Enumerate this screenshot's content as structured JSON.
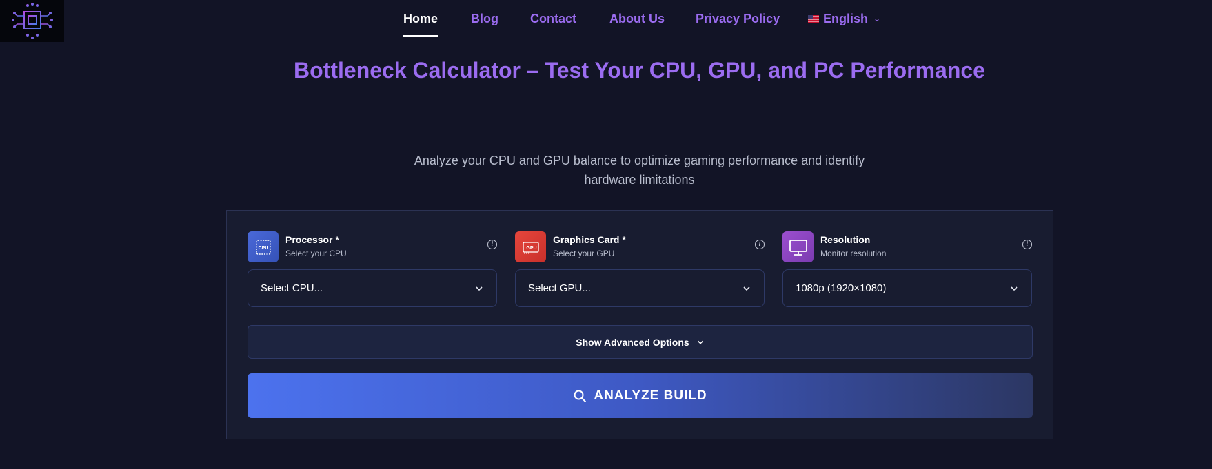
{
  "nav": {
    "items": [
      {
        "label": "Home",
        "active": true
      },
      {
        "label": "Blog"
      },
      {
        "label": "Contact"
      },
      {
        "label": "About Us"
      },
      {
        "label": "Privacy Policy"
      }
    ],
    "language": {
      "label": "English",
      "flag_icon": "us-flag-icon"
    }
  },
  "hero": {
    "title": "Bottleneck Calculator – Test Your CPU, GPU, and PC Performance",
    "subtitle": "Analyze your CPU and GPU balance to optimize gaming performance and identify hardware limitations"
  },
  "form": {
    "fields": [
      {
        "label": "Processor *",
        "sublabel": "Select your CPU",
        "icon": "cpu-icon",
        "icon_text": "CPU",
        "value": "Select CPU..."
      },
      {
        "label": "Graphics Card *",
        "sublabel": "Select your GPU",
        "icon": "gpu-icon",
        "icon_text": "GPU",
        "value": "Select GPU..."
      },
      {
        "label": "Resolution",
        "sublabel": "Monitor resolution",
        "icon": "monitor-icon",
        "value": "1080p (1920×1080)"
      }
    ],
    "info_glyph": "i",
    "advanced_label": "Show Advanced Options",
    "analyze_label": "ANALYZE BUILD"
  },
  "colors": {
    "background": "#121426",
    "accent_purple": "#9b6cf0",
    "card": "#181c30",
    "button_start": "#4c72ee",
    "button_end": "#2c3763"
  }
}
